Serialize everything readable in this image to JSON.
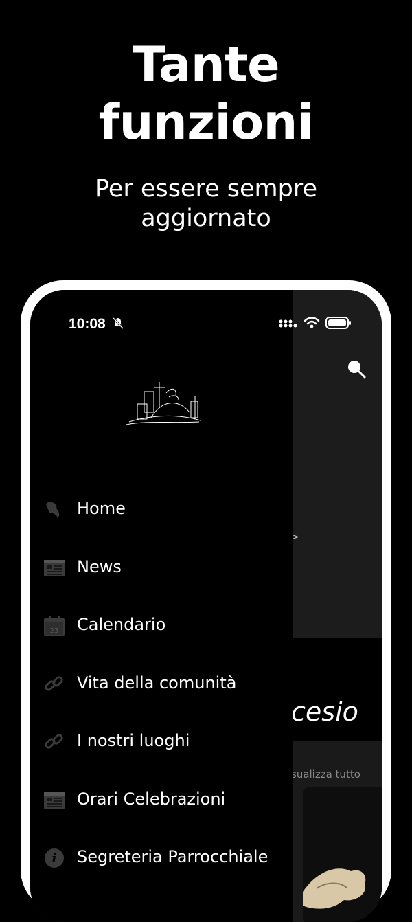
{
  "promo": {
    "title_line1": "Tante",
    "title_line2": "funzioni",
    "subtitle_line1": "Per essere sempre",
    "subtitle_line2": "aggiornato"
  },
  "status_bar": {
    "time": "10:08"
  },
  "drawer": {
    "items": [
      {
        "label": "Home",
        "icon": "home-icon"
      },
      {
        "label": "News",
        "icon": "newspaper-icon"
      },
      {
        "label": "Calendario",
        "icon": "calendar-icon"
      },
      {
        "label": "Vita della comunità",
        "icon": "link-icon"
      },
      {
        "label": "I nostri luoghi",
        "icon": "link-icon"
      },
      {
        "label": "Orari Celebrazioni",
        "icon": "newspaper-icon"
      },
      {
        "label": "Segreteria Parrocchiale",
        "icon": "info-icon"
      }
    ]
  },
  "background_screen": {
    "section_title_fragment": "cesio",
    "view_all_fragment": "sualizza tutto",
    "arrow_glyph": ">"
  },
  "colors": {
    "background": "#000000",
    "phone_frame": "#ffffff",
    "icon_gray": "#3a3a3a"
  }
}
